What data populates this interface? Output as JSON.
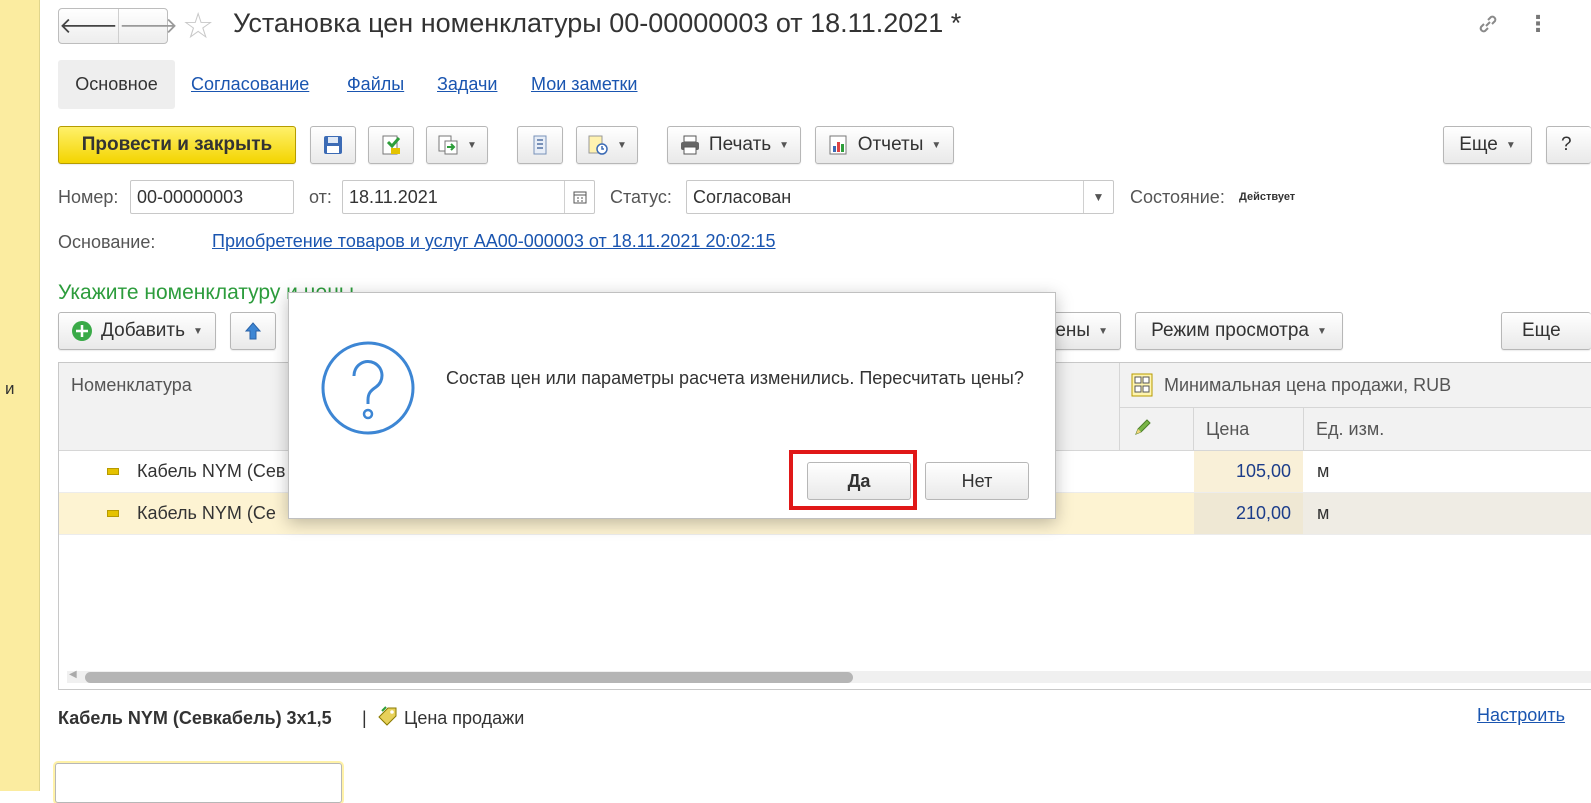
{
  "window": {
    "title": "Установка цен номенклатуры 00-00000003 от 18.11.2021 *",
    "nav_back": "🡐",
    "nav_forward": "🡒",
    "left_strip_char": "и"
  },
  "tabs": [
    {
      "label": "Основное",
      "active": true
    },
    {
      "label": "Согласование"
    },
    {
      "label": "Файлы"
    },
    {
      "label": "Задачи"
    },
    {
      "label": "Мои заметки"
    }
  ],
  "toolbar": {
    "post_close": "Провести и закрыть",
    "print": "Печать",
    "reports": "Отчеты",
    "more": "Еще",
    "help": "?"
  },
  "fields": {
    "number_label": "Номер:",
    "number_value": "00-00000003",
    "date_label": "от:",
    "date_value": "18.11.2021",
    "status_label": "Статус:",
    "status_value": "Согласован",
    "state_label": "Состояние:",
    "state_value": "Действует",
    "basis_label": "Основание:",
    "basis_link": "Приобретение товаров и услуг АА00-000003 от 18.11.2021 20:02:15"
  },
  "section": {
    "title": "Укажите номенклатуру и цены",
    "add": "Добавить",
    "prices_button": "Цены",
    "view_mode": "Режим просмотра",
    "more": "Еще"
  },
  "table": {
    "col_nomenclature": "Номенклатура",
    "group_header": "Минимальная цена продажи, RUB",
    "col_price": "Цена",
    "col_unit": "Ед. изм.",
    "rows": [
      {
        "name": "Кабель NYM (Сев",
        "price": "105,00",
        "unit": "м"
      },
      {
        "name": "Кабель NYM (Се",
        "price": "210,00",
        "unit": "м"
      }
    ]
  },
  "footer": {
    "item": "Кабель NYM (Севкабель) 3х1,5",
    "separator": "|",
    "price_type": "Цена продажи",
    "configure": "Настроить"
  },
  "dialog": {
    "message": "Состав цен или параметры расчета изменились. Пересчитать цены?",
    "yes": "Да",
    "no": "Нет"
  },
  "colors": {
    "accent_yellow": "#f3d400",
    "link_blue": "#1a55b0",
    "section_green": "#2c9c3c",
    "highlight_red": "#e01818",
    "dialog_icon_blue": "#3d86d4"
  }
}
